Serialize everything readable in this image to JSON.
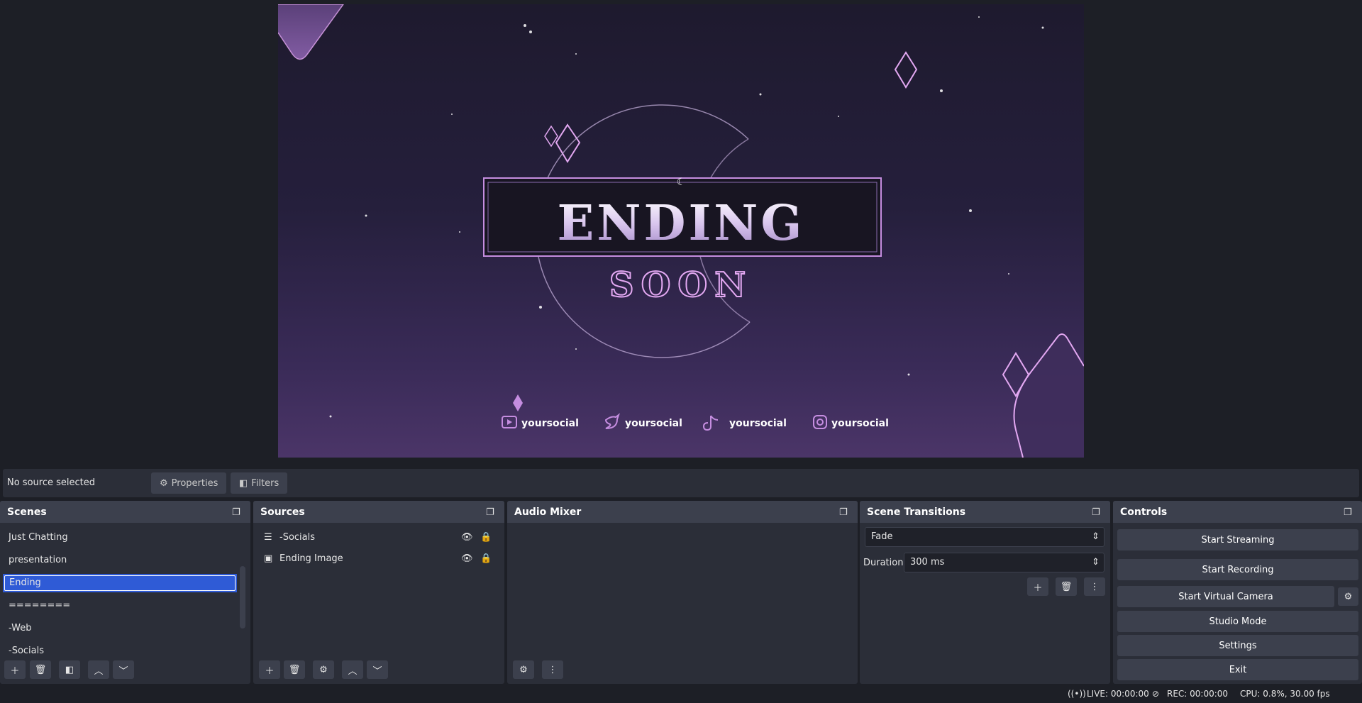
{
  "preview": {
    "headline": "ENDING",
    "subline": "SOON",
    "socials": [
      {
        "icon": "youtube-icon",
        "handle": "yoursocial"
      },
      {
        "icon": "twitter-icon",
        "handle": "yoursocial"
      },
      {
        "icon": "tiktok-icon",
        "handle": "yoursocial"
      },
      {
        "icon": "instagram-icon",
        "handle": "yoursocial"
      }
    ],
    "accent": "#c58de0"
  },
  "source_bar": {
    "status": "No source selected",
    "properties": "Properties",
    "filters": "Filters"
  },
  "scenes": {
    "title": "Scenes",
    "items": [
      "Just Chatting",
      "presentation",
      "Ending",
      "========",
      "-Web",
      "-Socials"
    ],
    "selected": "Ending"
  },
  "sources": {
    "title": "Sources",
    "items": [
      {
        "label": "-Socials",
        "icon": "group-list-icon"
      },
      {
        "label": "Ending Image",
        "icon": "image-icon"
      }
    ]
  },
  "audio_mixer": {
    "title": "Audio Mixer"
  },
  "transitions": {
    "title": "Scene Transitions",
    "selected": "Fade",
    "duration_label": "Duration",
    "duration_value": "300 ms"
  },
  "controls": {
    "title": "Controls",
    "start_streaming": "Start Streaming",
    "start_recording": "Start Recording",
    "start_virtual_camera": "Start Virtual Camera",
    "studio_mode": "Studio Mode",
    "settings": "Settings",
    "exit": "Exit"
  },
  "status": {
    "live": "LIVE: 00:00:00",
    "rec": "REC: 00:00:00",
    "cpu": "CPU: 0.8%, 30.00 fps"
  },
  "colors": {
    "background": "#1d1f26",
    "panel": "#2b2e38",
    "header": "#3c404d",
    "selection": "#2f5bd6"
  }
}
